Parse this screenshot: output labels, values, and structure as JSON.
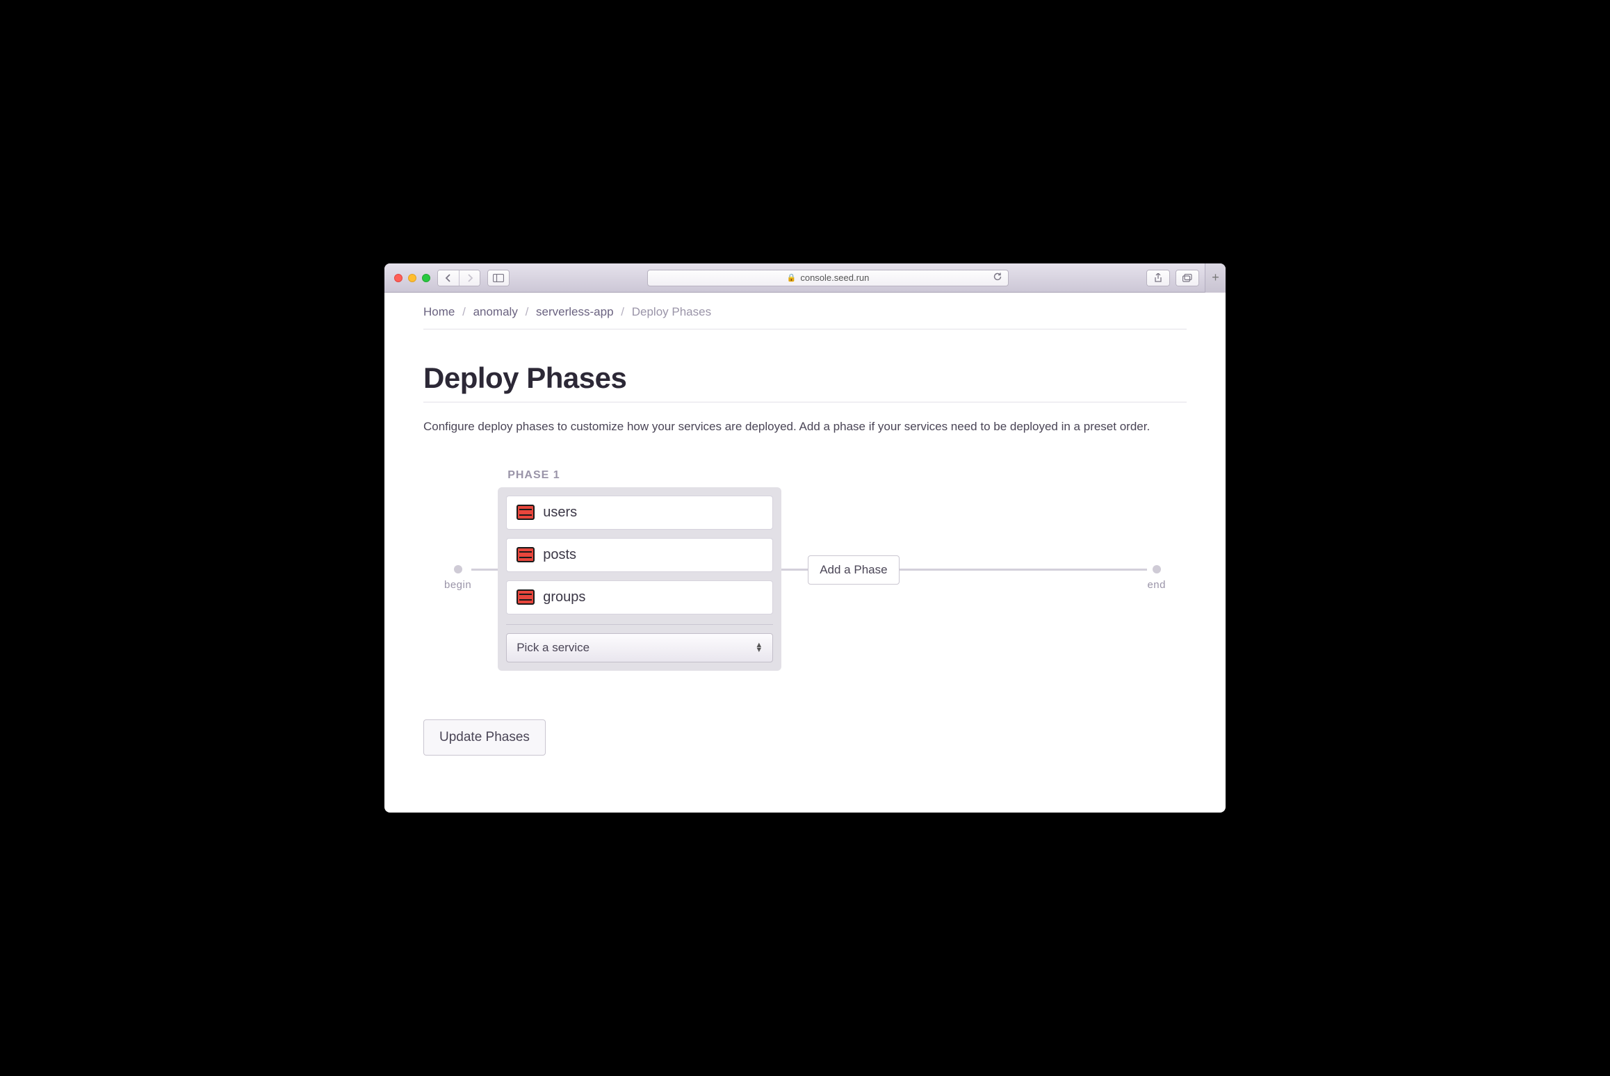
{
  "browser": {
    "url": "console.seed.run"
  },
  "breadcrumb": {
    "home": "Home",
    "org": "anomaly",
    "app": "serverless-app",
    "current": "Deploy Phases"
  },
  "page": {
    "title": "Deploy Phases",
    "description": "Configure deploy phases to customize how your services are deployed. Add a phase if your services need to be deployed in a preset order."
  },
  "flow": {
    "begin_label": "begin",
    "end_label": "end",
    "add_phase_label": "Add a Phase"
  },
  "phase": {
    "label": "PHASE 1",
    "services": [
      "users",
      "posts",
      "groups"
    ],
    "picker_label": "Pick a service"
  },
  "actions": {
    "update_label": "Update Phases"
  }
}
